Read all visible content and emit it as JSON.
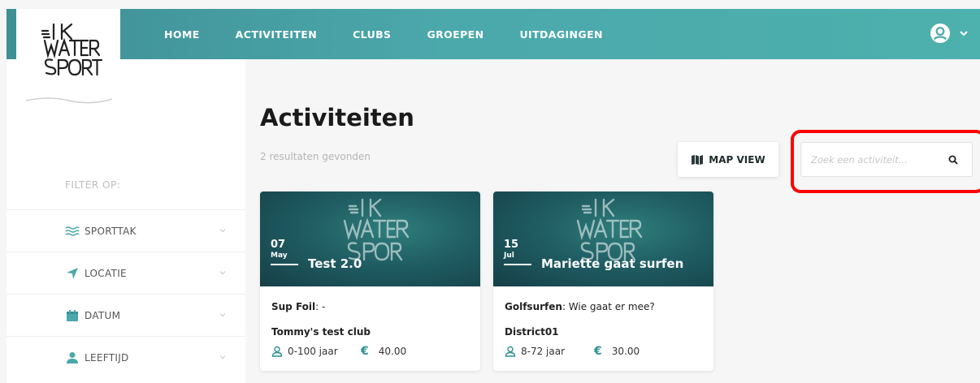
{
  "brand": {
    "logo_text": "IK WATER SPORT"
  },
  "nav": {
    "items": [
      "HOME",
      "ACTIVITEITEN",
      "CLUBS",
      "GROEPEN",
      "UITDAGINGEN"
    ]
  },
  "sidebar": {
    "title": "FILTER OP:",
    "filters": [
      {
        "label": "SPORTTAK",
        "icon": "waves-icon"
      },
      {
        "label": "LOCATIE",
        "icon": "location-arrow-icon"
      },
      {
        "label": "DATUM",
        "icon": "calendar-icon"
      },
      {
        "label": "LEEFTIJD",
        "icon": "person-icon"
      }
    ]
  },
  "main": {
    "heading": "Activiteiten",
    "results": "2 resultaten gevonden",
    "map_button": "MAP VIEW",
    "search_placeholder": "Zoek een activiteit..."
  },
  "cards": [
    {
      "day": "07",
      "month": "May",
      "title": "Test 2.0",
      "sport": "Sup Foil",
      "sport_desc": ": -",
      "club": "Tommy's test club",
      "age": "0-100 jaar",
      "price": "40.00"
    },
    {
      "day": "15",
      "month": "Jul",
      "title": "Mariette gaat surfen",
      "sport": "Golfsurfen",
      "sport_desc": ": Wie gaat er mee?",
      "club": "District01",
      "age": "8-72 jaar",
      "price": "30.00"
    }
  ],
  "colors": {
    "primary": "#4ba8ab",
    "accent": "#2f8f92",
    "highlight": "#ff0000"
  }
}
